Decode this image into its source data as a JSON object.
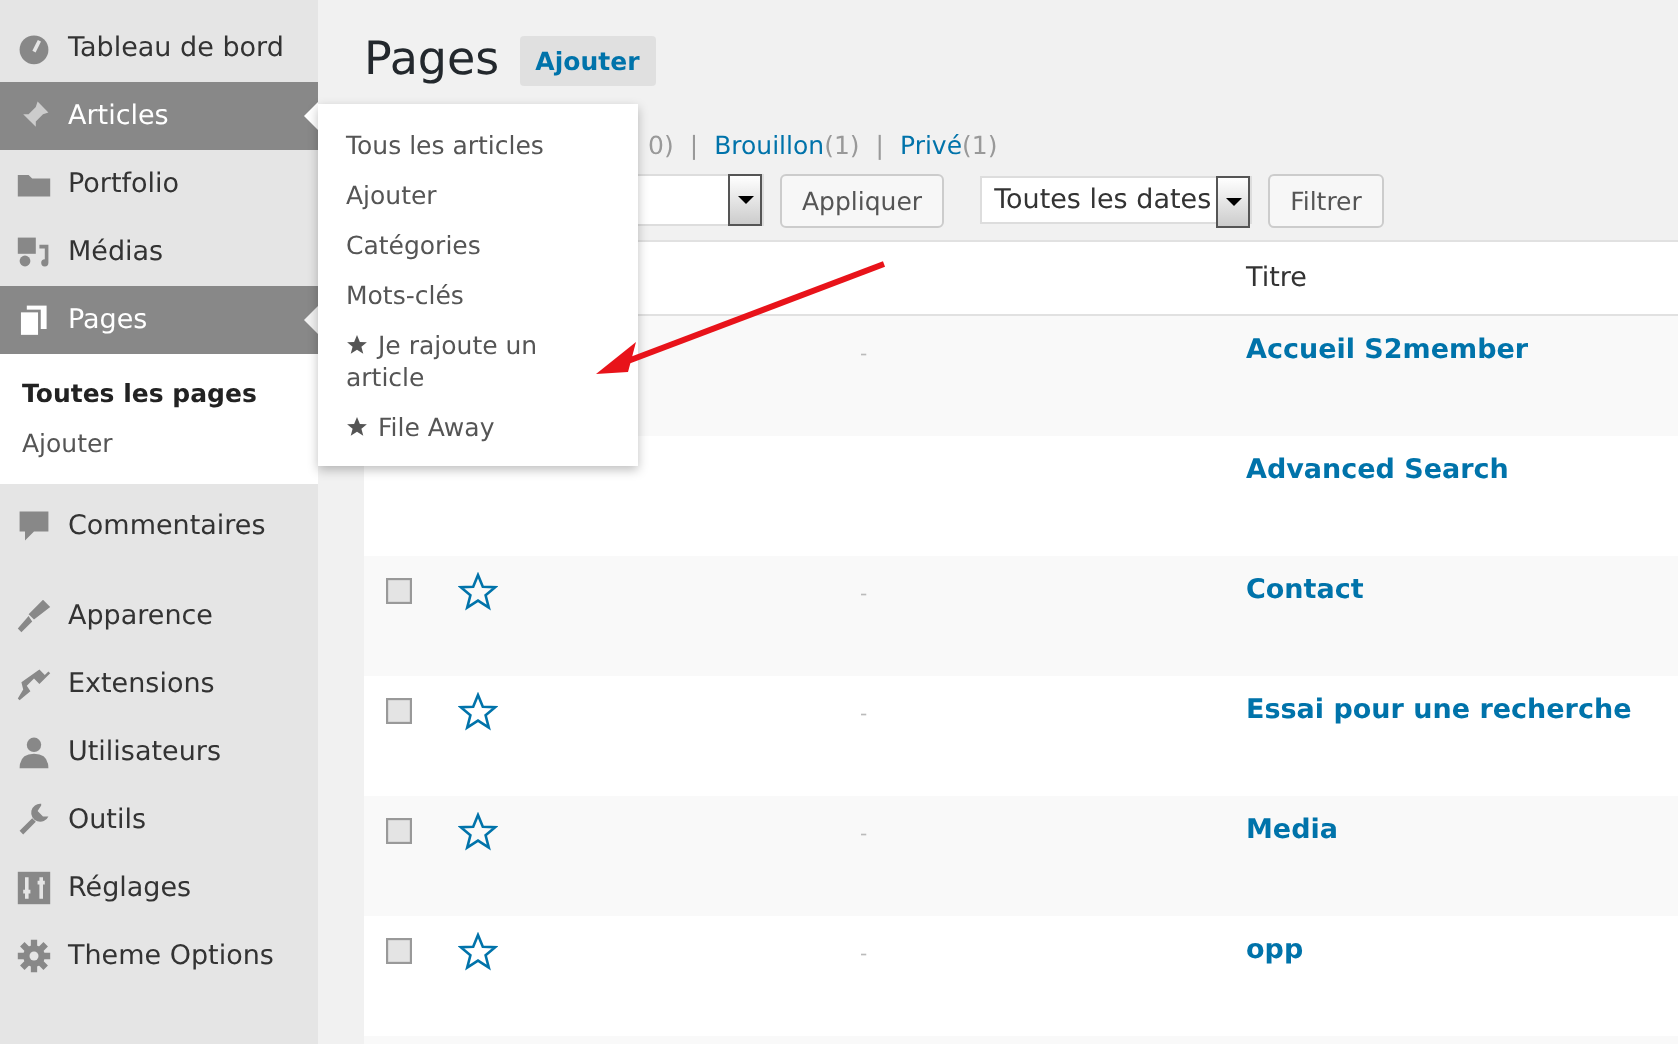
{
  "sidebar": {
    "items": [
      {
        "label": "Tableau de bord",
        "selected": false,
        "open": false
      },
      {
        "label": "Articles",
        "selected": false,
        "open": true
      },
      {
        "label": "Portfolio",
        "selected": false,
        "open": false
      },
      {
        "label": "Médias",
        "selected": false,
        "open": false
      },
      {
        "label": "Pages",
        "selected": true,
        "open": false,
        "children": [
          {
            "label": "Toutes les pages",
            "selected": true
          },
          {
            "label": "Ajouter",
            "selected": false
          }
        ]
      },
      {
        "label": "Commentaires",
        "selected": false,
        "open": false
      },
      {
        "label": "Apparence",
        "selected": false,
        "open": false
      },
      {
        "label": "Extensions",
        "selected": false,
        "open": false
      },
      {
        "label": "Utilisateurs",
        "selected": false,
        "open": false
      },
      {
        "label": "Outils",
        "selected": false,
        "open": false
      },
      {
        "label": "Réglages",
        "selected": false,
        "open": false
      },
      {
        "label": "Theme Options",
        "selected": false,
        "open": false
      }
    ]
  },
  "flyout": {
    "items": [
      {
        "label": "Tous les articles",
        "starred": false
      },
      {
        "label": "Ajouter",
        "starred": false
      },
      {
        "label": "Catégories",
        "starred": false
      },
      {
        "label": "Mots-clés",
        "starred": false
      },
      {
        "label": "Je rajoute un article",
        "starred": true
      },
      {
        "label": "File Away",
        "starred": true
      }
    ]
  },
  "page": {
    "title": "Pages",
    "add_button": "Ajouter"
  },
  "status_links": [
    {
      "label": "0)"
    },
    {
      "separator": "|",
      "label": "Brouillon",
      "count": "(1)"
    },
    {
      "separator": "|",
      "label": "Privé",
      "count": "(1)"
    }
  ],
  "bulk_actions": {
    "apply_button": "Appliquer"
  },
  "date_filter": {
    "value": "Toutes les dates",
    "filter_button": "Filtrer"
  },
  "table": {
    "columns": [
      "Titre"
    ],
    "rows": [
      {
        "title": "Accueil S2member",
        "mark": "-"
      },
      {
        "title": "Advanced Search"
      },
      {
        "title": "Contact",
        "mark": "-",
        "checkbox": true,
        "starred": false,
        "checked": false
      },
      {
        "title": "Essai pour une recherche",
        "mark": "-",
        "checkbox": true,
        "starred": false,
        "checked": false
      },
      {
        "title": "Media",
        "mark": "-",
        "checkbox": true,
        "starred": false,
        "checked": false
      },
      {
        "title": "opp",
        "mark": "-",
        "checkbox": true,
        "starred": false,
        "checked": false
      }
    ]
  }
}
